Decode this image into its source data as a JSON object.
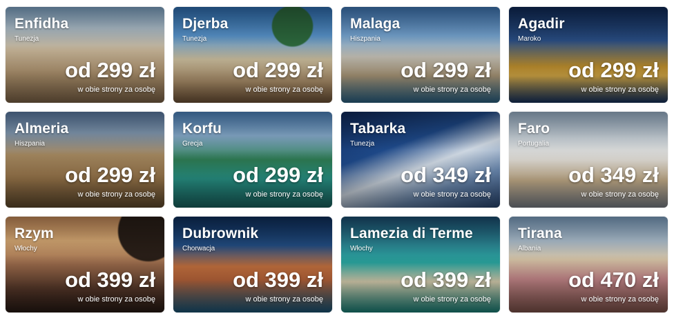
{
  "price_note": "w obie strony za osobę",
  "destinations": [
    {
      "city": "Enfidha",
      "country": "Tunezja",
      "price": "od 299 zł"
    },
    {
      "city": "Djerba",
      "country": "Tunezja",
      "price": "od 299 zł"
    },
    {
      "city": "Malaga",
      "country": "Hiszpania",
      "price": "od 299 zł"
    },
    {
      "city": "Agadir",
      "country": "Maroko",
      "price": "od 299 zł"
    },
    {
      "city": "Almeria",
      "country": "Hiszpania",
      "price": "od 299 zł"
    },
    {
      "city": "Korfu",
      "country": "Grecja",
      "price": "od 299 zł"
    },
    {
      "city": "Tabarka",
      "country": "Tunezja",
      "price": "od 349 zł"
    },
    {
      "city": "Faro",
      "country": "Portugalia",
      "price": "od 349 zł"
    },
    {
      "city": "Rzym",
      "country": "Włochy",
      "price": "od 399 zł"
    },
    {
      "city": "Dubrownik",
      "country": "Chorwacja",
      "price": "od 399 zł"
    },
    {
      "city": "Lamezia di Terme",
      "country": "Włochy",
      "price": "od 399 zł"
    },
    {
      "city": "Tirana",
      "country": "Albania",
      "price": "od 470 zł"
    }
  ]
}
